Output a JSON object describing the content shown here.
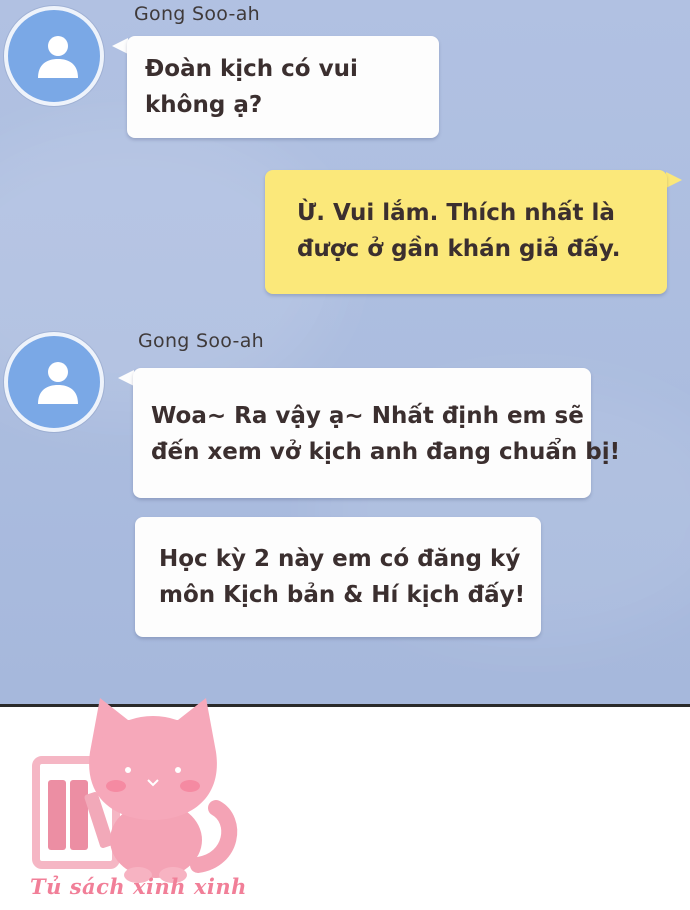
{
  "colors": {
    "chat_background": "#adbee0",
    "incoming_bubble": "#fdfdfd",
    "outgoing_bubble": "#fbe87a",
    "avatar": "#7aa8e6",
    "watermark_pink": "#f4a3b5"
  },
  "messages": [
    {
      "sender": "Gong Soo-ah",
      "avatar_icon": "user-icon",
      "lines": [
        "Đoàn kịch có vui",
        "không ạ?"
      ]
    },
    {
      "sender": "",
      "lines": [
        "Ừ. Vui lắm. Thích nhất là",
        "được ở gần khán giả đấy."
      ]
    },
    {
      "sender": "Gong Soo-ah",
      "avatar_icon": "user-icon",
      "lines": [
        "Woa~ Ra vậy ạ~ Nhất định em sẽ",
        "đến xem vở kịch anh đang chuẩn bị!"
      ]
    },
    {
      "sender": "",
      "lines": [
        "Học kỳ 2 này em có đăng ký",
        "môn Kịch bản & Hí kịch đấy!"
      ]
    }
  ],
  "watermark": {
    "caption": "Tủ sách xinh xinh",
    "icon": "pink-cat-books-logo"
  }
}
